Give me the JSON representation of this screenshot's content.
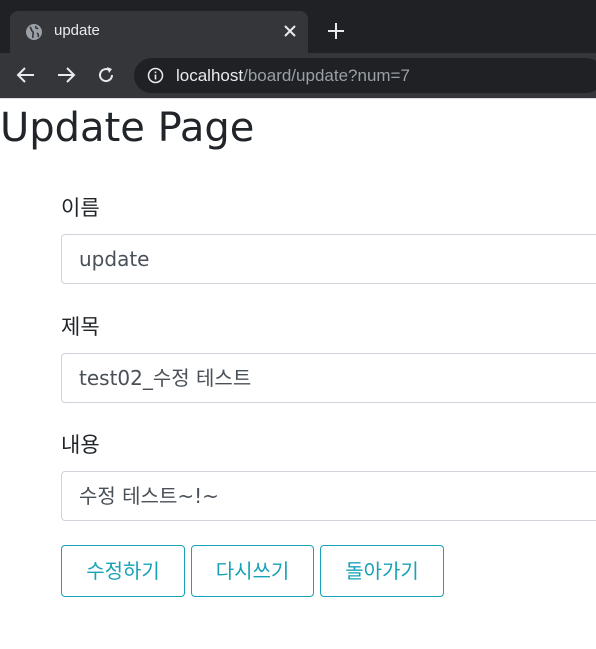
{
  "browser": {
    "tab_title": "update",
    "url_host": "localhost",
    "url_path": "/board/update?num=7"
  },
  "page": {
    "title": "Update Page"
  },
  "form": {
    "name": {
      "label": "이름",
      "value": "update"
    },
    "subject": {
      "label": "제목",
      "value": "test02_수정 테스트"
    },
    "content": {
      "label": "내용",
      "value": "수정 테스트~!~"
    }
  },
  "buttons": {
    "update": "수정하기",
    "reset": "다시쓰기",
    "back": "돌아가기"
  },
  "colors": {
    "accent": "#17a2b8",
    "chrome_dark": "#202124",
    "chrome_tab": "#35363a"
  }
}
